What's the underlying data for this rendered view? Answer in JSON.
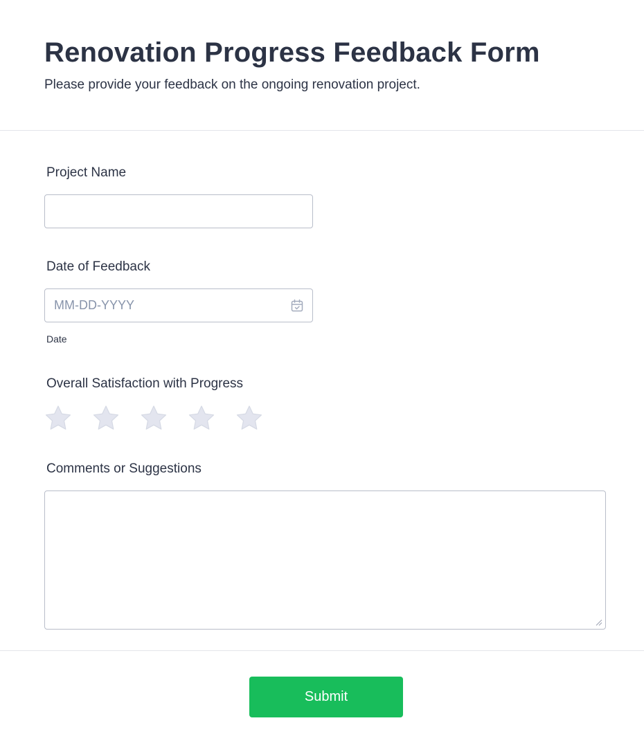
{
  "header": {
    "title": "Renovation Progress Feedback Form",
    "subtitle": "Please provide your feedback on the ongoing renovation project."
  },
  "fields": {
    "project_name": {
      "label": "Project Name",
      "value": "",
      "placeholder": ""
    },
    "date_of_feedback": {
      "label": "Date of Feedback",
      "value": "",
      "placeholder": "MM-DD-YYYY",
      "sublabel": "Date",
      "icon": "calendar-icon"
    },
    "satisfaction": {
      "label": "Overall Satisfaction with Progress",
      "max_stars": 5,
      "rating": 0,
      "icon": "star-icon"
    },
    "comments": {
      "label": "Comments or Suggestions",
      "value": "",
      "placeholder": ""
    }
  },
  "submit": {
    "label": "Submit"
  },
  "colors": {
    "text": "#2c3345",
    "placeholder": "#8894ab",
    "border": "#b8bdc9",
    "star_empty": "#e3e5ef",
    "submit_bg": "#18bd5b",
    "divider": "#e3e5ea"
  }
}
